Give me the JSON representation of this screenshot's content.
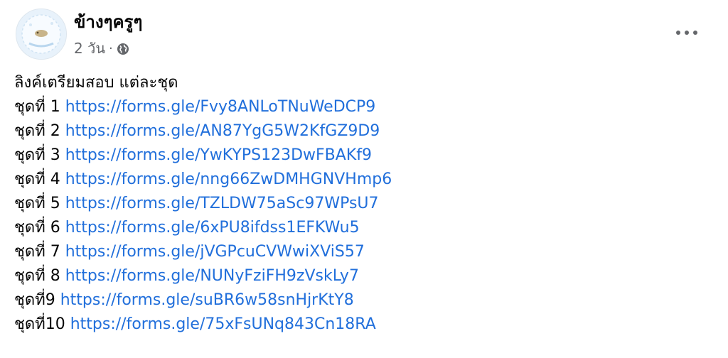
{
  "post": {
    "author": "ข้างๆครูๆ",
    "time": "2 วัน",
    "separator": "·",
    "privacy_icon": "globe-icon",
    "more_icon": "more-options-icon"
  },
  "content": {
    "intro": "ลิงค์เตรียมสอบ แต่ละชุด",
    "sets": [
      {
        "label": "ชุดที่ 1",
        "url": "https://forms.gle/Fvy8ANLoTNuWeDCP9"
      },
      {
        "label": "ชุดที่ 2",
        "url": "https://forms.gle/AN87YgG5W2KfGZ9D9"
      },
      {
        "label": "ชุดที่ 3",
        "url": "https://forms.gle/YwKYPS123DwFBAKf9"
      },
      {
        "label": "ชุดที่ 4",
        "url": "https://forms.gle/nng66ZwDMHGNVHmp6"
      },
      {
        "label": "ชุดที่ 5",
        "url": "https://forms.gle/TZLDW75aSc97WPsU7"
      },
      {
        "label": "ชุดที่ 6",
        "url": "https://forms.gle/6xPU8ifdss1EFKWu5"
      },
      {
        "label": "ชุดที่ 7",
        "url": "https://forms.gle/jVGPcuCVWwiXViS57"
      },
      {
        "label": "ชุดที่ 8",
        "url": "https://forms.gle/NUNyFziFH9zVskLy7"
      },
      {
        "label": "ชุดที่9",
        "url": "https://forms.gle/suBR6w58snHjrKtY8"
      },
      {
        "label": "ชุดที่10",
        "url": "https://forms.gle/75xFsUNq843Cn18RA"
      }
    ]
  },
  "colors": {
    "link": "#216fdb",
    "text": "#050505",
    "meta": "#65676b",
    "background": "#ffffff"
  }
}
